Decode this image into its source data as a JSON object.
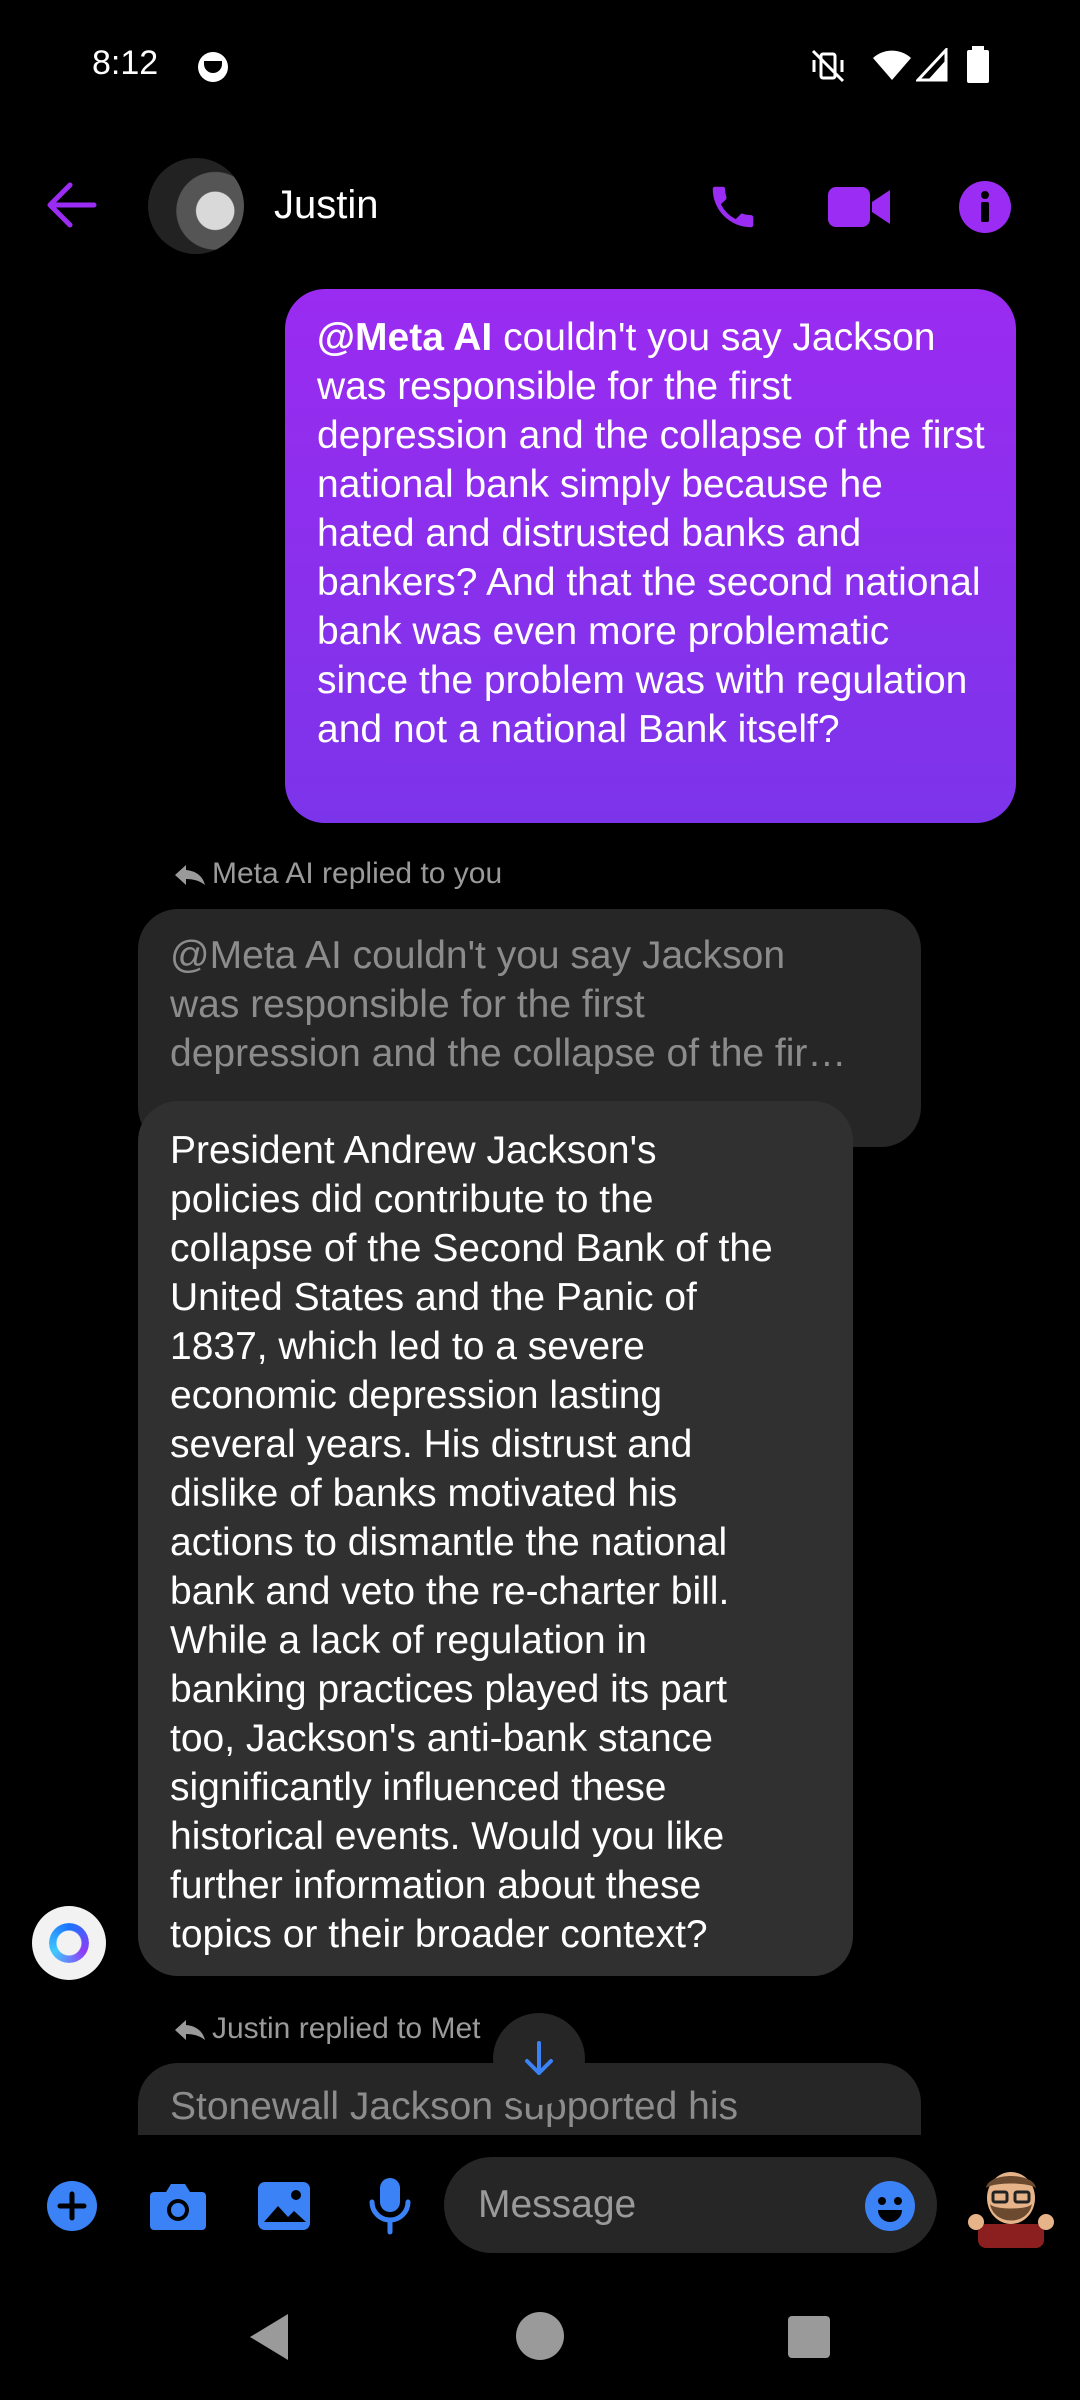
{
  "status_bar": {
    "time": "8:12"
  },
  "header": {
    "contact_name": "Justin"
  },
  "sent_message": {
    "mention": "@Meta AI",
    "text": " couldn't you say Jackson was responsible for the first depression and the collapse of the first national bank simply because he hated and distrusted banks and bankers? And that the second national bank was even more problematic since the problem was with regulation and not a national Bank itself?"
  },
  "reply_note_1": "Meta AI replied to you",
  "quoted_message_lines": [
    "@Meta AI couldn't you say Jackson",
    "was responsible for the first",
    "depression and the collapse of the fir…"
  ],
  "ai_reply_lines": [
    "President Andrew Jackson's",
    "policies did contribute to the",
    "collapse of the Second Bank of the",
    "United States and the Panic of",
    "1837, which led to a severe",
    "economic depression lasting",
    "several years. His distrust and",
    "dislike of banks motivated his",
    "actions to dismantle the national",
    "bank and veto the re-charter bill.",
    "While a lack of regulation in",
    "banking practices played its part",
    "too, Jackson's anti-bank stance",
    "significantly influenced these",
    "historical events. Would you like",
    "further information about these",
    "topics or their broader context?"
  ],
  "reply_note_2": "Justin replied to Met",
  "quoted_message_2": "Stonewall Jackson supported his",
  "composer": {
    "placeholder": "Message"
  },
  "colors": {
    "accent": "#9b2cf3",
    "blue": "#3b82f6",
    "sent_bubble": "#8a30ee",
    "received_bubble": "#303030"
  }
}
